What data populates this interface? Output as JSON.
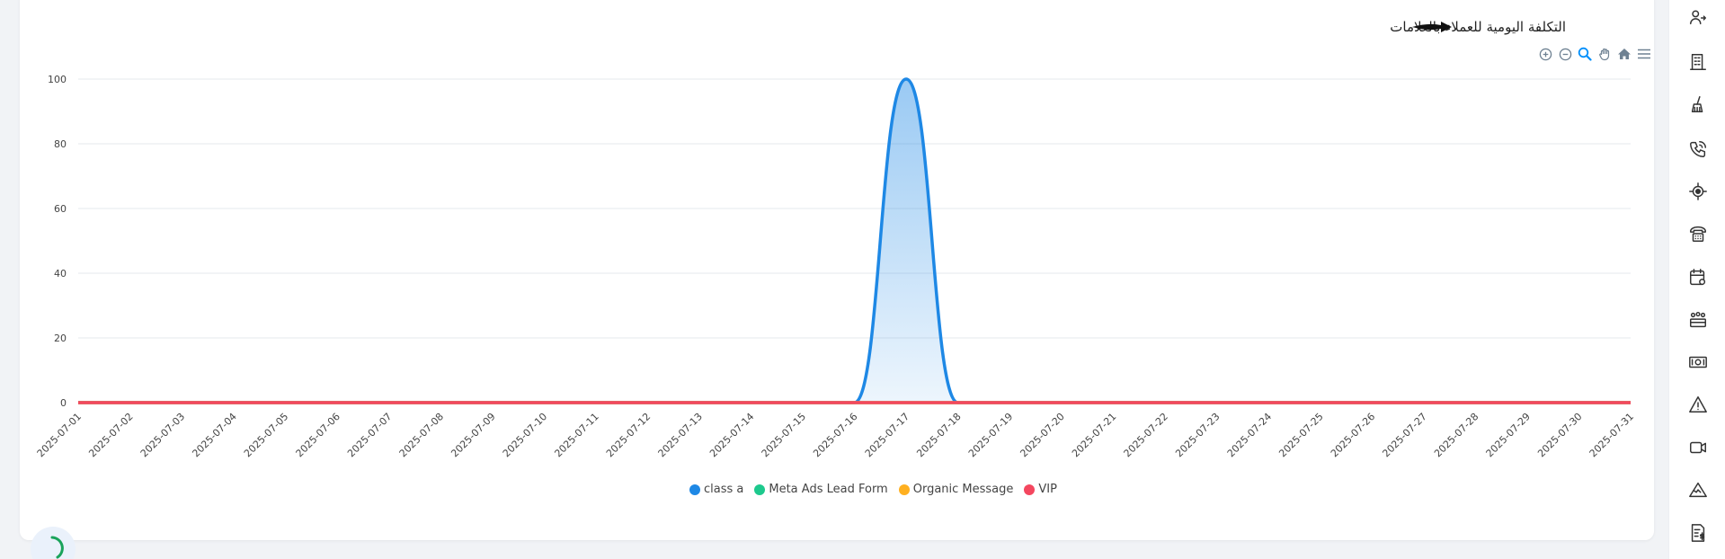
{
  "chart_data": {
    "type": "area",
    "title": "التكلفة اليومية للعملاء بالعلامات",
    "x": [
      "2025-07-01",
      "2025-07-02",
      "2025-07-03",
      "2025-07-04",
      "2025-07-05",
      "2025-07-06",
      "2025-07-07",
      "2025-07-08",
      "2025-07-09",
      "2025-07-10",
      "2025-07-11",
      "2025-07-12",
      "2025-07-13",
      "2025-07-14",
      "2025-07-15",
      "2025-07-16",
      "2025-07-17",
      "2025-07-18",
      "2025-07-19",
      "2025-07-20",
      "2025-07-21",
      "2025-07-22",
      "2025-07-23",
      "2025-07-24",
      "2025-07-25",
      "2025-07-26",
      "2025-07-27",
      "2025-07-28",
      "2025-07-29",
      "2025-07-30",
      "2025-07-31"
    ],
    "yticks": [
      "0",
      "20",
      "40",
      "60",
      "80",
      "100"
    ],
    "ylim": [
      0,
      100
    ],
    "series": [
      {
        "name": "class a",
        "color": "#1e88e5",
        "values": [
          0,
          0,
          0,
          0,
          0,
          0,
          0,
          0,
          0,
          0,
          0,
          0,
          0,
          0,
          0,
          0,
          100,
          0,
          0,
          0,
          0,
          0,
          0,
          0,
          0,
          0,
          0,
          0,
          0,
          0,
          0
        ]
      },
      {
        "name": "Meta Ads Lead Form",
        "color": "#1dc98d",
        "values": [
          0,
          0,
          0,
          0,
          0,
          0,
          0,
          0,
          0,
          0,
          0,
          0,
          0,
          0,
          0,
          0,
          0,
          0,
          0,
          0,
          0,
          0,
          0,
          0,
          0,
          0,
          0,
          0,
          0,
          0,
          0
        ]
      },
      {
        "name": "Organic Message",
        "color": "#ffb020",
        "values": [
          0,
          0,
          0,
          0,
          0,
          0,
          0,
          0,
          0,
          0,
          0,
          0,
          0,
          0,
          0,
          0,
          0,
          0,
          0,
          0,
          0,
          0,
          0,
          0,
          0,
          0,
          0,
          0,
          0,
          0,
          0
        ]
      },
      {
        "name": "VIP",
        "color": "#f4475f",
        "values": [
          0,
          0,
          0,
          0,
          0,
          0,
          0,
          0,
          0,
          0,
          0,
          0,
          0,
          0,
          0,
          0,
          0,
          0,
          0,
          0,
          0,
          0,
          0,
          0,
          0,
          0,
          0,
          0,
          0,
          0,
          0
        ]
      }
    ],
    "grid": true,
    "legend_position": "bottom-center"
  },
  "toolbar": {
    "icons": [
      "zoom-in-icon",
      "zoom-out-icon",
      "selection-zoom-icon",
      "pan-icon",
      "reset-home-icon",
      "menu-icon"
    ]
  },
  "sidebar": {
    "icons": [
      "users-swap-icon",
      "building-icon",
      "broom-icon",
      "phone-ringing-icon",
      "target-icon",
      "telephone-icon",
      "calendar-gear-icon",
      "group-icon",
      "cash-icon",
      "warning-icon",
      "video-icon",
      "mountain-icon",
      "invoice-dollar-icon"
    ]
  }
}
